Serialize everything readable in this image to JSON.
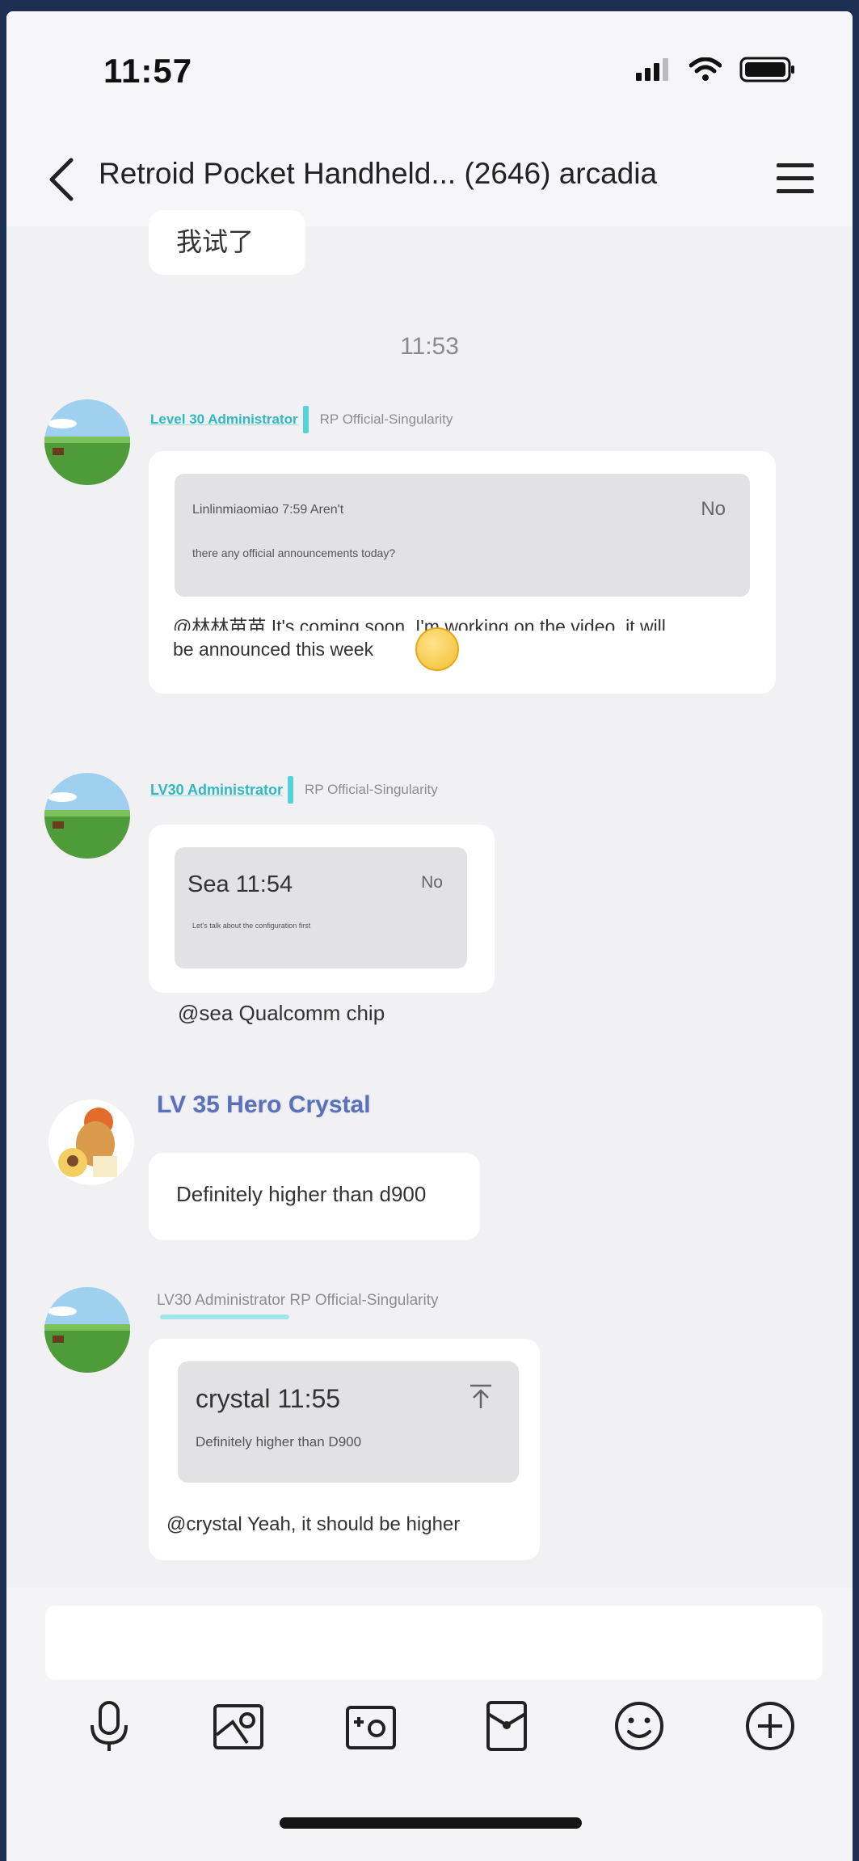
{
  "statusbar": {
    "time": "11:57"
  },
  "navbar": {
    "title": "Retroid Pocket Handheld... (2646) arcadia"
  },
  "chat": {
    "partial_text": "我试了",
    "timestamp": "11:53",
    "messages": [
      {
        "rank": "Level 30 Administrator",
        "role": "RP Official-Singularity",
        "quote_header": "Linlinmiaomiao 7:59 Aren't",
        "quote_tag": "No",
        "quote_body": "there any official announcements today?",
        "line1": "@林林苗苗 It's coming soon, I'm working on the video, it will",
        "line2": "be announced this week"
      },
      {
        "rank": "LV30 Administrator",
        "role": "RP Official-Singularity",
        "quote_header": "Sea 11:54",
        "quote_tag": "No",
        "quote_body": "Let's talk about the configuration first",
        "line1": "@sea Qualcomm chip"
      },
      {
        "name": "LV 35 Hero Crystal",
        "line1": "Definitely higher than d900"
      },
      {
        "role": "LV30 Administrator RP Official-Singularity",
        "quote_header": "crystal 11:55",
        "quote_body": "Definitely higher than D900",
        "line1": "@crystal Yeah, it should be higher"
      }
    ]
  },
  "colors": {
    "accent": "#56d3d9",
    "background": "#f1f1f3",
    "bubble": "#ffffff",
    "quote": "#e2e2e4"
  },
  "icons": [
    "back-chevron-icon",
    "hamburger-menu-icon",
    "microphone-icon",
    "image-icon",
    "camera-icon",
    "red-envelope-icon",
    "emoji-icon",
    "plus-icon"
  ]
}
